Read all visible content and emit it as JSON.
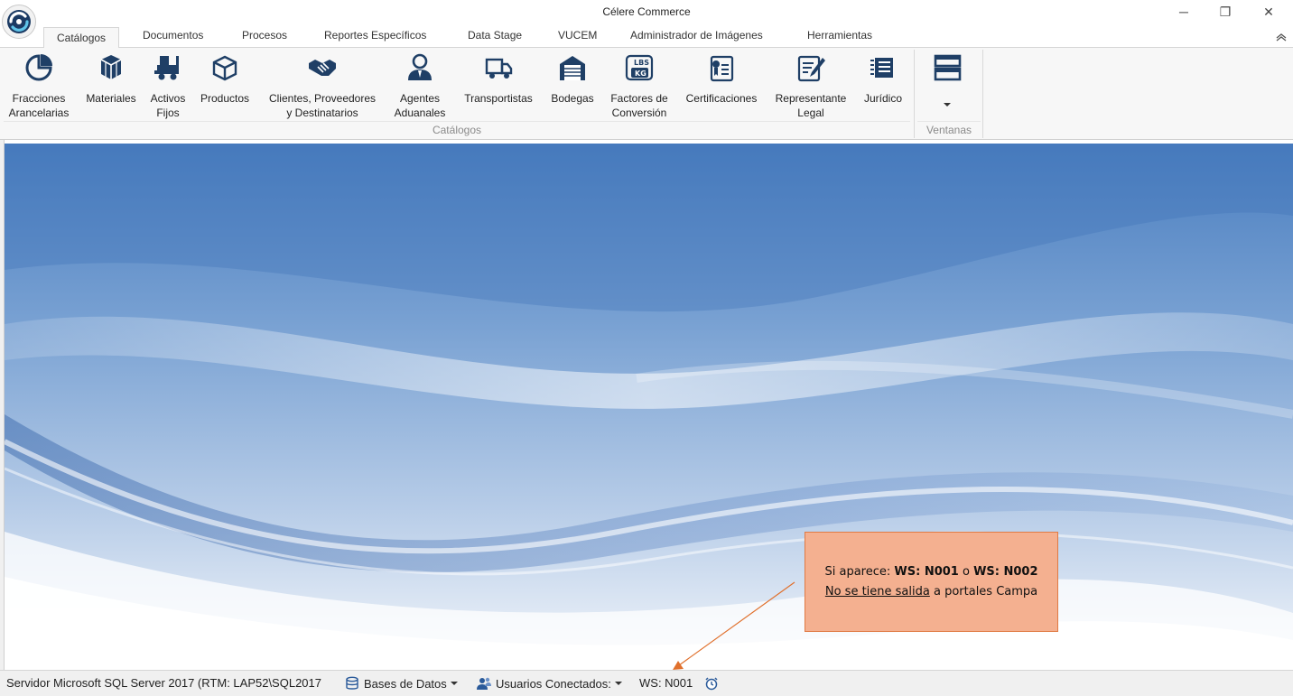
{
  "window": {
    "title": "Célere Commerce",
    "minimize_glyph": "─",
    "restore_glyph": "❐",
    "close_glyph": "✕"
  },
  "tabs": [
    {
      "label": "Catálogos",
      "active": true
    },
    {
      "label": "Documentos"
    },
    {
      "label": "Procesos"
    },
    {
      "label": "Reportes Específicos"
    },
    {
      "label": "Data Stage"
    },
    {
      "label": "VUCEM"
    },
    {
      "label": "Administrador de Imágenes"
    },
    {
      "label": "Herramientas"
    }
  ],
  "ribbon": {
    "buttons": [
      {
        "label": "Fracciones\nArancelarias",
        "icon": "pie-chart-icon"
      },
      {
        "label": "Materiales",
        "icon": "cubes-icon"
      },
      {
        "label": "Activos\nFijos",
        "icon": "forklift-icon"
      },
      {
        "label": "Productos",
        "icon": "box-icon"
      },
      {
        "label": "Clientes, Proveedores\ny Destinatarios",
        "icon": "handshake-icon"
      },
      {
        "label": "Agentes\nAduanales",
        "icon": "person-icon"
      },
      {
        "label": "Transportistas",
        "icon": "truck-icon"
      },
      {
        "label": "Bodegas",
        "icon": "warehouse-icon"
      },
      {
        "label": "Factores de\nConversión",
        "icon": "weight-conversion-icon"
      },
      {
        "label": "Certificaciones",
        "icon": "certificate-icon"
      },
      {
        "label": "Representante\nLegal",
        "icon": "edit-document-icon"
      },
      {
        "label": "Jurídico",
        "icon": "legal-list-icon"
      }
    ],
    "group_catalogos_label": "Catálogos",
    "group_ventanas_label": "Ventanas",
    "icon_color": "#1f3f66"
  },
  "callout": {
    "prefix": "Si aparece: ",
    "code1": "WS: N001",
    "joiner": " o ",
    "code2": "WS: N002",
    "underlined": "No se tiene salida",
    "suffix": " a portales Campa",
    "fill_color": "#f4b090",
    "border_color": "#e07a44"
  },
  "statusbar": {
    "server": "Servidor Microsoft SQL Server 2017 (RTM: LAP52\\SQL2017",
    "databases": "Bases de Datos",
    "users": "Usuarios Conectados:",
    "ws": "WS: N001"
  }
}
